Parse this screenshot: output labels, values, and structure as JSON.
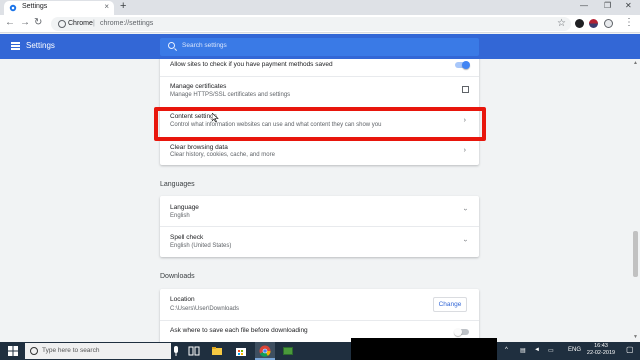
{
  "browser": {
    "tab": {
      "title": "Settings",
      "favicon": "gear-icon"
    },
    "omnibox": {
      "site_label": "Chrome",
      "separator": "|",
      "url": "chrome://settings"
    }
  },
  "settings": {
    "title": "Settings",
    "search_placeholder": "Search settings"
  },
  "privacy_rows": [
    {
      "title": "Allow sites to check if you have payment methods saved",
      "toggle": true
    },
    {
      "title": "Manage certificates",
      "subtitle": "Manage HTTPS/SSL certificates and settings"
    },
    {
      "title": "Content settings",
      "subtitle": "Control what information websites can use and what content they can show you"
    },
    {
      "title": "Clear browsing data",
      "subtitle": "Clear history, cookies, cache, and more"
    }
  ],
  "languages": {
    "section_title": "Languages",
    "rows": [
      {
        "title": "Language",
        "subtitle": "English"
      },
      {
        "title": "Spell check",
        "subtitle": "English (United States)"
      }
    ]
  },
  "downloads": {
    "section_title": "Downloads",
    "location_title": "Location",
    "location_value": "C:\\Users\\User\\Downloads",
    "change_label": "Change",
    "ask_title": "Ask where to save each file before downloading",
    "ask_toggle": false
  },
  "taskbar": {
    "search_placeholder": "Type here to search",
    "lang": "ENG",
    "time": "16:43",
    "date": "22-02-2019"
  },
  "colors": {
    "header_blue": "#3367d6",
    "highlight_red": "#e8160c",
    "toggle_on": "#4285f4"
  }
}
